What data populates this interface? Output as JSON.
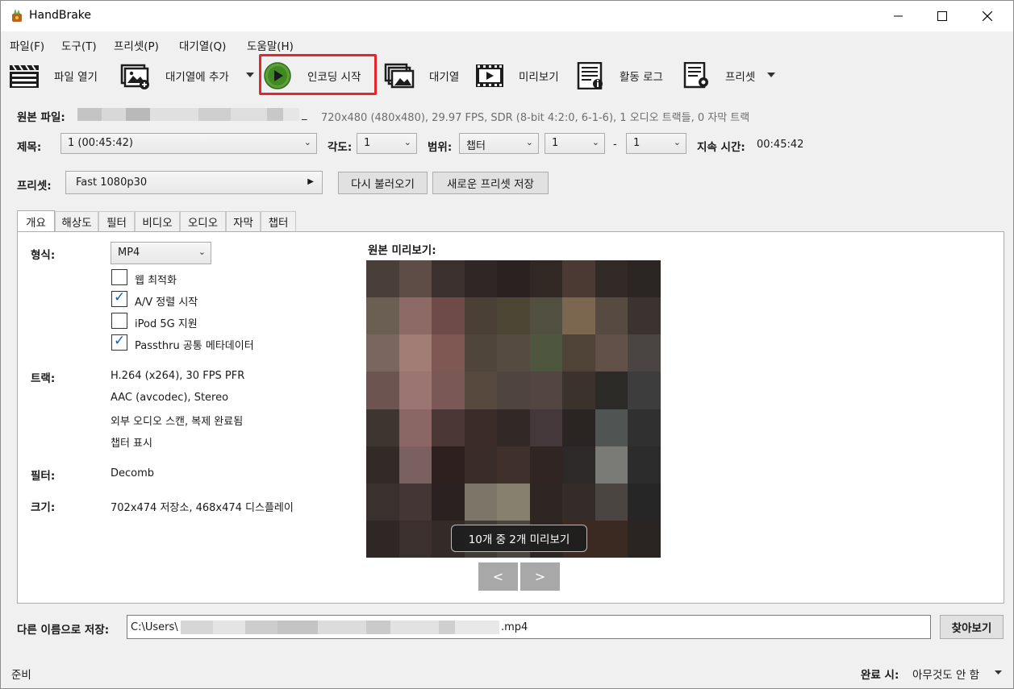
{
  "window": {
    "title": "HandBrake"
  },
  "menu": [
    "파일(F)",
    "도구(T)",
    "프리셋(P)",
    "대기열(Q)",
    "도움말(H)"
  ],
  "toolbar": {
    "open_source": "파일 열기",
    "add_queue": "대기열에 추가",
    "start_encode": "인코딩 시작",
    "queue": "대기열",
    "preview": "미리보기",
    "activity_log": "활동 로그",
    "presets": "프리셋"
  },
  "source": {
    "label": "원본 파일:",
    "suffix": "_",
    "info": "720x480 (480x480), 29.97 FPS, SDR (8-bit 4:2:0, 6-1-6), 1 오디오 트랙들, 0 자막 트랙"
  },
  "title_row": {
    "title_label": "제목:",
    "title_value": "1  (00:45:42)",
    "angle_label": "각도:",
    "angle_value": "1",
    "range_label": "범위:",
    "range_type": "챕터",
    "range_start": "1",
    "range_sep": "-",
    "range_end": "1",
    "duration_label": "지속 시간:",
    "duration_value": "00:45:42"
  },
  "preset_row": {
    "label": "프리셋:",
    "value": "Fast 1080p30",
    "reload": "다시 불러오기",
    "save_new": "새로운 프리셋 저장"
  },
  "tabs": [
    "개요",
    "해상도",
    "필터",
    "비디오",
    "오디오",
    "자막",
    "챕터"
  ],
  "summary": {
    "format_label": "형식:",
    "format_value": "MP4",
    "checks": [
      {
        "label": "웹 최적화",
        "checked": false
      },
      {
        "label": "A/V 정렬 시작",
        "checked": true
      },
      {
        "label": "iPod 5G 지원",
        "checked": false
      },
      {
        "label": "Passthru 공통 메타데이터",
        "checked": true
      }
    ],
    "tracks_label": "트랙:",
    "tracks": [
      "H.264 (x264), 30 FPS PFR",
      "AAC (avcodec), Stereo",
      "외부 오디오 스캔, 복제 완료됨",
      "챕터 표시"
    ],
    "filters_label": "필터:",
    "filters_value": "Decomb",
    "size_label": "크기:",
    "size_value": "702x474 저장소, 468x474 디스플레이",
    "preview_label": "원본 미리보기:",
    "preview_badge": "10개 중 2개 미리보기",
    "prev_btn": "<",
    "next_btn": ">"
  },
  "save": {
    "label": "다른 이름으로 저장:",
    "path_prefix": "C:\\Users\\",
    "path_suffix": ".mp4",
    "browse": "찾아보기"
  },
  "status": {
    "text": "준비",
    "when_done_label": "완료 시:",
    "when_done_value": "아무것도 안 함"
  }
}
